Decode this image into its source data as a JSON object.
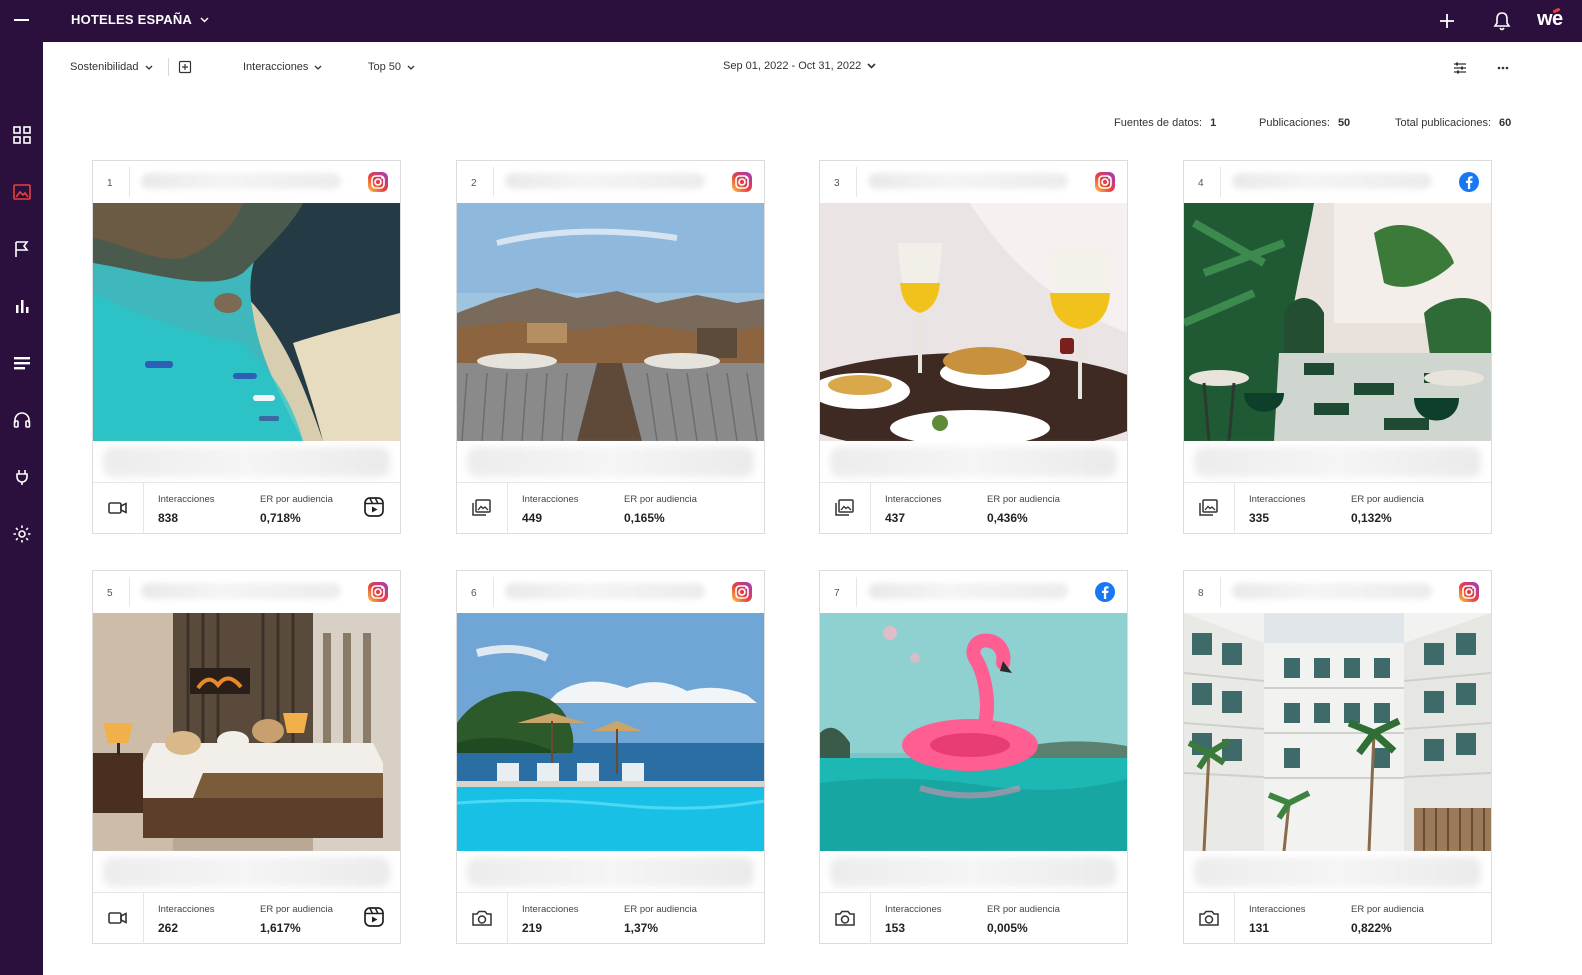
{
  "header": {
    "brand": "HOTELES ESPAÑA",
    "logo": "we",
    "colors": {
      "bar": "#2b0f3d",
      "accent": "#e8413d"
    },
    "icons": [
      "menu-icon",
      "plus-icon",
      "bell-icon"
    ]
  },
  "sidebar": {
    "items": [
      {
        "name": "dashboard-icon"
      },
      {
        "name": "image-icon",
        "active": true
      },
      {
        "name": "flag-icon"
      },
      {
        "name": "bar-chart-icon"
      },
      {
        "name": "list-icon"
      },
      {
        "name": "headset-icon"
      },
      {
        "name": "plug-icon"
      },
      {
        "name": "settings-icon"
      }
    ]
  },
  "toolbar": {
    "topic": "Sostenibilidad",
    "metric": "Interacciones",
    "top": "Top 50",
    "date_range": "Sep 01, 2022 - Oct 31, 2022"
  },
  "stats": {
    "sources_label": "Fuentes de datos:",
    "sources_value": "1",
    "posts_label": "Publicaciones:",
    "posts_value": "50",
    "total_label": "Total publicaciones:",
    "total_value": "60"
  },
  "cards": [
    {
      "rank": "1",
      "network": "instagram",
      "type": "video",
      "reel": true,
      "interactions_label": "Interacciones",
      "interactions": "838",
      "er_label": "ER por audiencia",
      "er": "0,718%",
      "photo": "beach-aerial"
    },
    {
      "rank": "2",
      "network": "instagram",
      "type": "gallery",
      "reel": false,
      "interactions_label": "Interacciones",
      "interactions": "449",
      "er_label": "ER por audiencia",
      "er": "0,165%",
      "photo": "mountain-loungers"
    },
    {
      "rank": "3",
      "network": "instagram",
      "type": "gallery",
      "reel": false,
      "interactions_label": "Interacciones",
      "interactions": "437",
      "er_label": "ER por audiencia",
      "er": "0,436%",
      "photo": "breakfast-glasses"
    },
    {
      "rank": "4",
      "network": "facebook",
      "type": "gallery",
      "reel": false,
      "interactions_label": "Interacciones",
      "interactions": "335",
      "er_label": "ER por audiencia",
      "er": "0,132%",
      "photo": "garden-terrace"
    },
    {
      "rank": "5",
      "network": "instagram",
      "type": "video",
      "reel": true,
      "interactions_label": "Interacciones",
      "interactions": "262",
      "er_label": "ER por audiencia",
      "er": "1,617%",
      "photo": "hotel-bedroom"
    },
    {
      "rank": "6",
      "network": "instagram",
      "type": "photo",
      "reel": false,
      "interactions_label": "Interacciones",
      "interactions": "219",
      "er_label": "ER por audiencia",
      "er": "1,37%",
      "photo": "infinity-pool"
    },
    {
      "rank": "7",
      "network": "facebook",
      "type": "photo",
      "reel": false,
      "interactions_label": "Interacciones",
      "interactions": "153",
      "er_label": "ER por audiencia",
      "er": "0,005%",
      "photo": "flamingo-float"
    },
    {
      "rank": "8",
      "network": "instagram",
      "type": "photo",
      "reel": false,
      "interactions_label": "Interacciones",
      "interactions": "131",
      "er_label": "ER por audiencia",
      "er": "0,822%",
      "photo": "hotel-courtyard"
    }
  ]
}
